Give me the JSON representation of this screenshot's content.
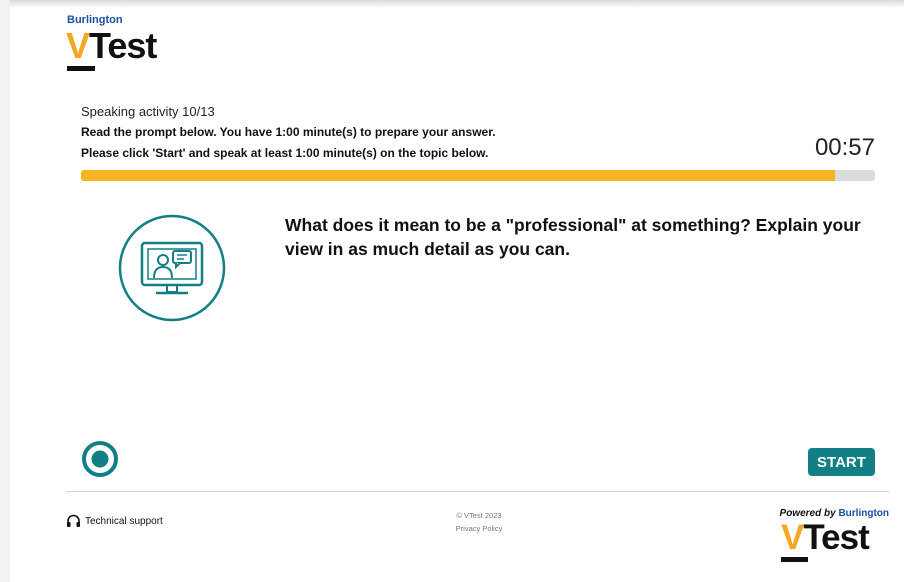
{
  "logo": {
    "brand": "Burlington",
    "mark_v": "V",
    "mark_rest": "Test"
  },
  "activity": {
    "counter": "Speaking activity 10/13",
    "instruction_1": "Read the prompt below. You have 1:00 minute(s) to prepare your answer.",
    "instruction_2": "Please click 'Start' and speak at least 1:00 minute(s) on the topic below.",
    "timer": "00:57",
    "progress_fraction": 0.95
  },
  "prompt": {
    "text": "What does it mean to be a \"professional\" at something? Explain your view in as much detail as you can."
  },
  "actions": {
    "start_label": "START"
  },
  "footer": {
    "support_label": "Technical support",
    "copyright": "© VTest 2023",
    "privacy": "Privacy Policy",
    "powered_prefix": "Powered by",
    "powered_brand": "Burlington",
    "mark_v": "V",
    "mark_rest": "Test"
  },
  "colors": {
    "accent_teal": "#127f86",
    "progress_yellow": "#f6b323",
    "brand_blue": "#1b4fa0",
    "logo_orange": "#f5a623"
  },
  "icons": [
    "video-call-icon",
    "record-indicator-icon",
    "headset-icon"
  ]
}
